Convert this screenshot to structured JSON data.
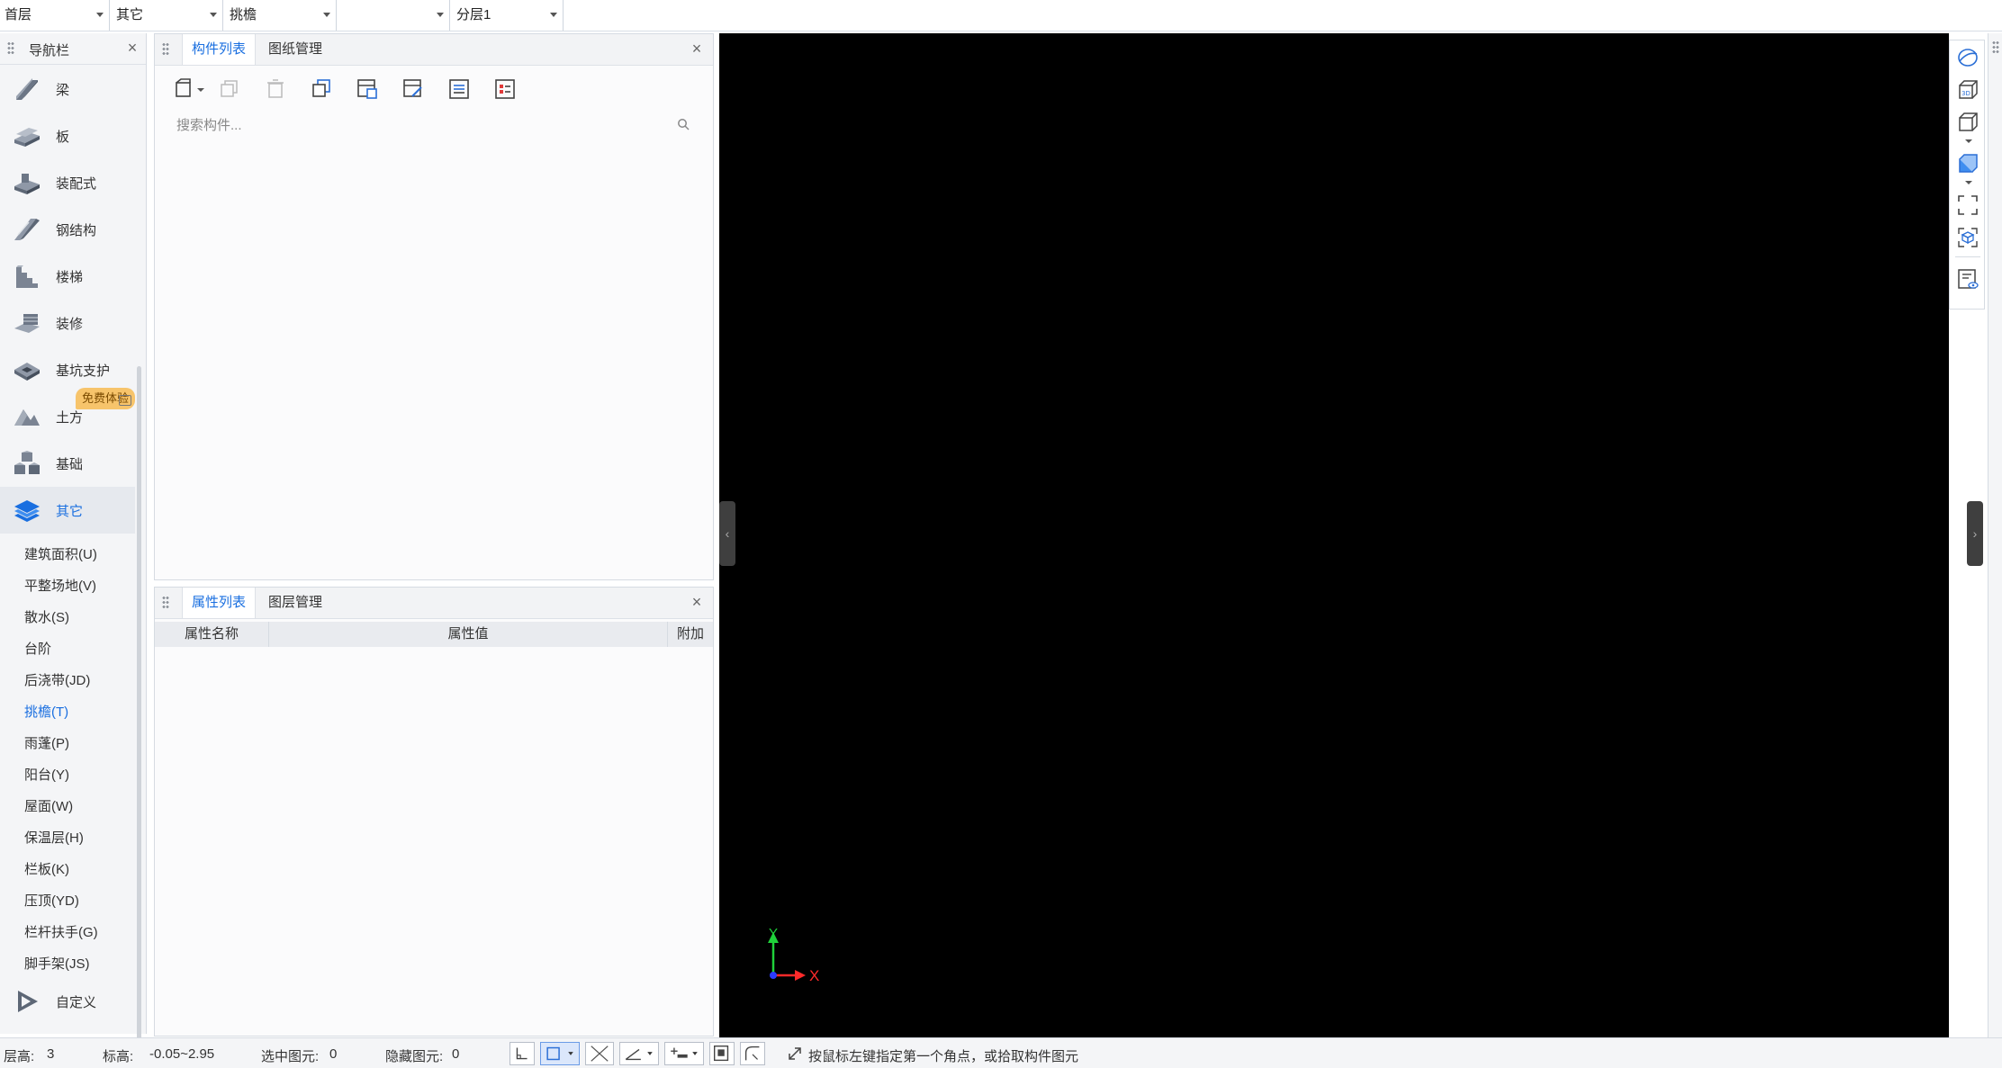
{
  "topbar": {
    "floor": "首层",
    "category": "其它",
    "component_type": "挑檐",
    "component": "",
    "layer": "分层1"
  },
  "nav": {
    "title": "导航栏",
    "items": [
      {
        "label": "梁",
        "icon": "beam-icon"
      },
      {
        "label": "板",
        "icon": "slab-icon"
      },
      {
        "label": "装配式",
        "icon": "prefab-icon"
      },
      {
        "label": "钢结构",
        "icon": "steel-structure-icon"
      },
      {
        "label": "楼梯",
        "icon": "stairs-icon"
      },
      {
        "label": "装修",
        "icon": "decoration-icon"
      },
      {
        "label": "基坑支护",
        "icon": "foundation-pit-icon"
      },
      {
        "label": "土方",
        "icon": "earthwork-icon"
      },
      {
        "label": "基础",
        "icon": "foundation-icon"
      },
      {
        "label": "其它",
        "icon": "other-layers-icon"
      }
    ],
    "badge": "免费体验",
    "sub_items": [
      "建筑面积(U)",
      "平整场地(V)",
      "散水(S)",
      "台阶",
      "后浇带(JD)",
      "挑檐(T)",
      "雨蓬(P)",
      "阳台(Y)",
      "屋面(W)",
      "保温层(H)",
      "栏板(K)",
      "压顶(YD)",
      "栏杆扶手(G)",
      "脚手架(JS)"
    ],
    "selected_sub": "挑檐(T)",
    "custom": {
      "label": "自定义",
      "icon": "custom-play-icon"
    }
  },
  "component_panel": {
    "tabs": [
      "构件列表",
      "图纸管理"
    ],
    "active_tab": "构件列表",
    "search_placeholder": "搜索构件..."
  },
  "property_panel": {
    "tabs": [
      "属性列表",
      "图层管理"
    ],
    "active_tab": "属性列表",
    "columns": [
      "属性名称",
      "属性值",
      "附加"
    ]
  },
  "canvas": {
    "axis_x": "X",
    "axis_y": "Y",
    "axis_colors": {
      "x": "#ff2a2a",
      "y": "#1fd13a",
      "origin": "#2a3bff"
    },
    "background": "#000000"
  },
  "status": {
    "floor_height_label": "层高:",
    "floor_height_value": "3",
    "elevation_label": "标高:",
    "elevation_value": "-0.05~2.95",
    "selected_label": "选中图元:",
    "selected_value": "0",
    "hidden_label": "隐藏图元:",
    "hidden_value": "0",
    "hint": "按鼠标左键指定第一个角点，或拾取构件图元"
  },
  "colors": {
    "accent": "#1a6fe0",
    "badge": "#f7c46b"
  }
}
